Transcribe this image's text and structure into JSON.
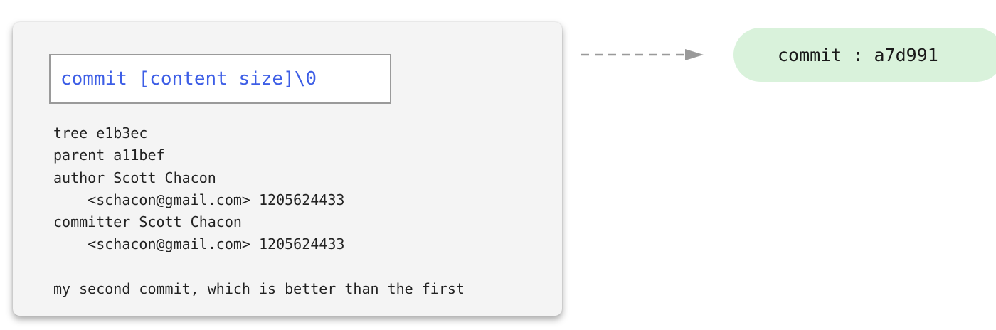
{
  "object_card": {
    "header": "commit [content size]\\0",
    "lines": [
      "tree e1b3ec",
      "parent a11bef",
      "author Scott Chacon",
      "    <schacon@gmail.com> 1205624433",
      "committer Scott Chacon",
      "    <schacon@gmail.com> 1205624433",
      "",
      "my second commit, which is better than the first"
    ]
  },
  "result_node": {
    "label": "commit : a7d991"
  },
  "colors": {
    "header_text": "#3d5ee6",
    "pill_fill": "#d9f2db",
    "card_fill": "#f4f4f4",
    "arrow": "#9a9a9a"
  }
}
